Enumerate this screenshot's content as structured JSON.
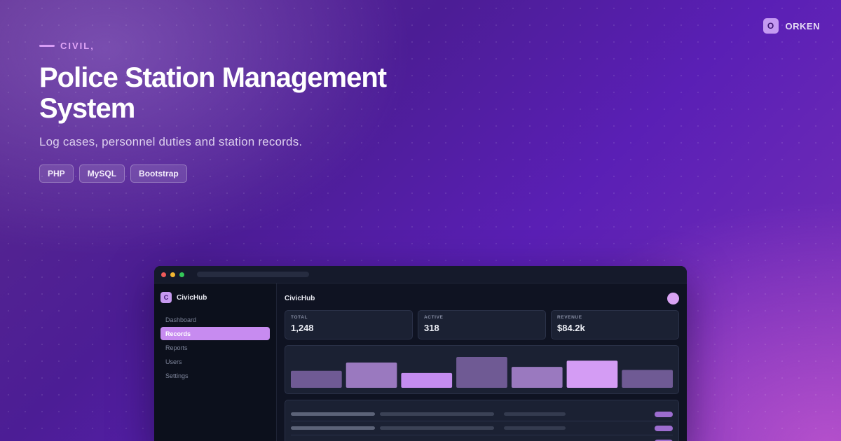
{
  "brand": {
    "logo_letter": "O",
    "name": "ORKEN"
  },
  "hero": {
    "eyebrow": "CIVIL,",
    "title": "Police Station Management System",
    "subtitle": "Log cases, personnel duties and station records.",
    "tags": [
      "PHP",
      "MySQL",
      "Bootstrap"
    ]
  },
  "app": {
    "sidebar": {
      "logo_letter": "C",
      "name": "CivicHub",
      "items": [
        "Dashboard",
        "Records",
        "Reports",
        "Users",
        "Settings"
      ],
      "active_index": 1
    },
    "main": {
      "title": "CivicHub",
      "stats": [
        {
          "label": "TOTAL",
          "value": "1,248"
        },
        {
          "label": "ACTIVE",
          "value": "318"
        },
        {
          "label": "REVENUE",
          "value": "$84.2k"
        }
      ],
      "chart_data": {
        "type": "bar",
        "values": [
          0.55,
          0.82,
          0.48,
          1.0,
          0.68,
          0.88,
          0.58
        ],
        "colors": [
          "#6f5a94",
          "#9a79bf",
          "#c48cf0",
          "#6f5a94",
          "#9a79bf",
          "#d49cf4",
          "#6f5a94"
        ],
        "ylim": [
          0,
          1
        ]
      },
      "table_rows": 3
    }
  },
  "colors": {
    "accent": "#c78bf0",
    "background": "#4c1d95"
  }
}
